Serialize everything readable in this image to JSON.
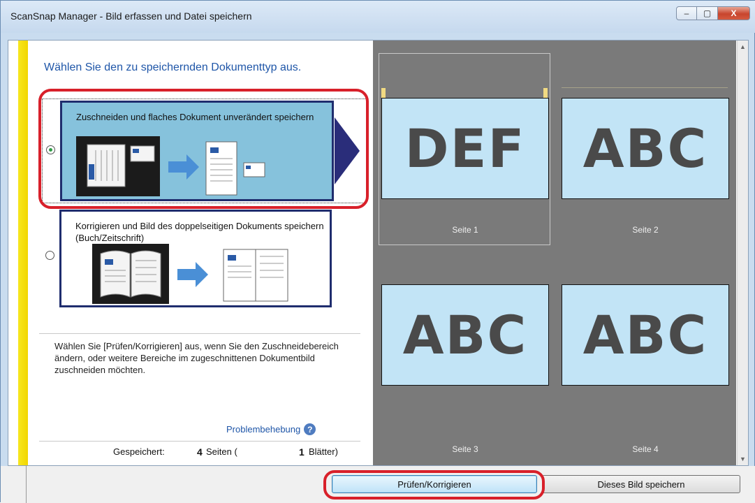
{
  "window": {
    "title": "ScanSnap Manager - Bild erfassen und Datei speichern",
    "controls": {
      "minimize": "–",
      "maximize": "▢",
      "close": "X"
    }
  },
  "left": {
    "heading": "Wählen Sie den zu speichernden Dokumenttyp aus.",
    "options": [
      {
        "label": "Zuschneiden und flaches Dokument unverändert speichern",
        "selected": true
      },
      {
        "label": "Korrigieren und Bild des doppelseitigen Dokuments speichern (Buch/Zeitschrift)",
        "selected": false
      }
    ],
    "info": "Wählen Sie [Prüfen/Korrigieren] aus, wenn Sie den Zuschneidebereich ändern, oder weitere Bereiche im zugeschnittenen Dokumentbild zuschneiden möchten.",
    "help_link": "Problembehebung",
    "saved": {
      "label": "Gespeichert:",
      "pages_count": "4",
      "pages_text": "Seiten (",
      "sheets_count": "1",
      "sheets_text": "Blätter)"
    }
  },
  "thumbnails": [
    {
      "text": "DEF",
      "label": "Seite 1"
    },
    {
      "text": "ABC",
      "label": "Seite 2"
    },
    {
      "text": "ABC",
      "label": "Seite 3"
    },
    {
      "text": "ABC",
      "label": "Seite 4"
    }
  ],
  "buttons": {
    "review": "Prüfen/Korrigieren",
    "save": "Dieses Bild speichern"
  },
  "colors": {
    "accent_frame": "#d8202a",
    "selected_option_bg": "#86c2dc",
    "thumb_bg": "#c2e4f6",
    "preview_bg": "#7a7a7a"
  }
}
